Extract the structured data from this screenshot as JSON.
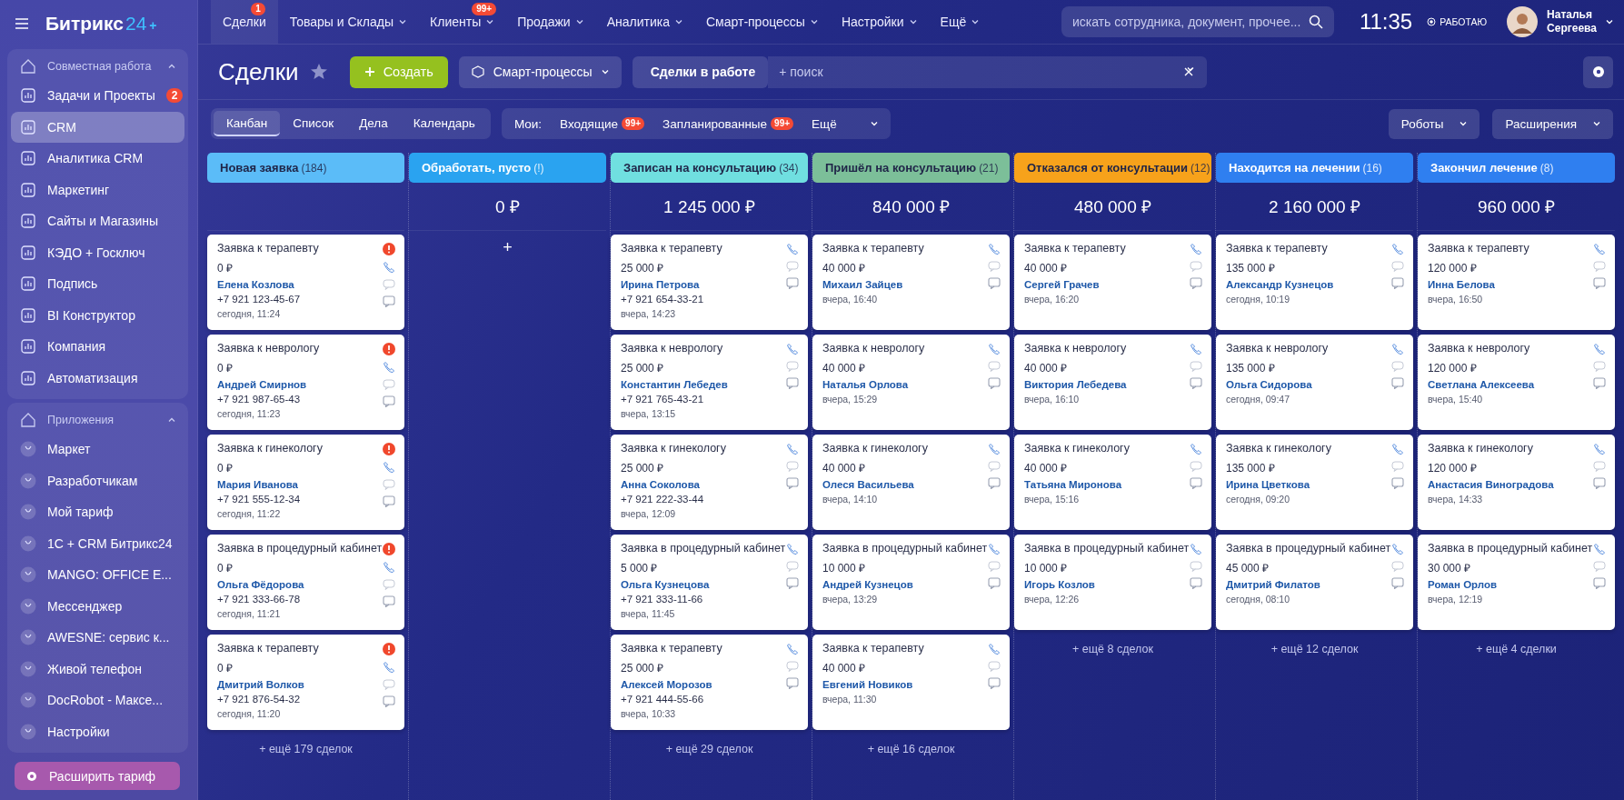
{
  "logo": {
    "name": "Битрикс",
    "number": "24",
    "plus": "+"
  },
  "top_nav": [
    {
      "label": "Сделки",
      "selected": true,
      "badge": "1",
      "dropdown": false
    },
    {
      "label": "Товары и Склады",
      "selected": false,
      "dropdown": true
    },
    {
      "label": "Клиенты",
      "selected": false,
      "badge": "99+",
      "dropdown": true
    },
    {
      "label": "Продажи",
      "selected": false,
      "dropdown": true
    },
    {
      "label": "Аналитика",
      "selected": false,
      "dropdown": true
    },
    {
      "label": "Смарт-процессы",
      "selected": false,
      "dropdown": true
    },
    {
      "label": "Настройки",
      "selected": false,
      "dropdown": true
    },
    {
      "label": "Ещё",
      "selected": false,
      "dropdown": true
    }
  ],
  "global_search": {
    "placeholder": "искать сотрудника, документ, прочее..."
  },
  "clock": "11:35",
  "work_status": "РАБОТАЮ",
  "user": {
    "first_name": "Наталья",
    "last_name": "Сергеева"
  },
  "sidebar": {
    "groups": [
      {
        "title": "Совместная работа",
        "expanded": true,
        "items": [
          {
            "label": "Задачи и Проекты",
            "selected": false,
            "badge": "2"
          },
          {
            "label": "CRM",
            "selected": true
          },
          {
            "label": "Аналитика CRM",
            "selected": false
          },
          {
            "label": "Маркетинг",
            "selected": false
          },
          {
            "label": "Сайты и Магазины",
            "selected": false
          },
          {
            "label": "КЭДО + Госключ",
            "selected": false
          },
          {
            "label": "Подпись",
            "selected": false
          },
          {
            "label": "BI Конструктор",
            "selected": false
          },
          {
            "label": "Компания",
            "selected": false
          },
          {
            "label": "Автоматизация",
            "selected": false
          }
        ]
      },
      {
        "title": "Приложения",
        "expanded": true,
        "items": [
          {
            "label": "Маркет",
            "selected": false
          },
          {
            "label": "Разработчикам",
            "selected": false
          },
          {
            "label": "Мой тариф",
            "selected": false
          },
          {
            "label": "1С + CRM Битрикс24",
            "selected": false
          },
          {
            "label": "MANGO: OFFICE E...",
            "selected": false
          },
          {
            "label": "Мессенджер",
            "selected": false
          },
          {
            "label": "AWESNE: сервис к...",
            "selected": false
          },
          {
            "label": "Живой телефон",
            "selected": false
          },
          {
            "label": "DocRobot - Максе...",
            "selected": false
          },
          {
            "label": "Настройки",
            "selected": false
          }
        ]
      }
    ],
    "upgrade_button": "Расширить тариф"
  },
  "page_title": "Сделки",
  "create_button": "Создать",
  "smart_button": "Смарт-процессы",
  "filter": {
    "preset": "Сделки в работе",
    "placeholder": "+ поиск"
  },
  "view_tabs": [
    {
      "label": "Канбан",
      "selected": true
    },
    {
      "label": "Список",
      "selected": false
    },
    {
      "label": "Дела",
      "selected": false
    },
    {
      "label": "Календарь",
      "selected": false
    }
  ],
  "my_filter": {
    "label": "Мои:",
    "items": [
      {
        "label": "Входящие",
        "badge": "99+"
      },
      {
        "label": "Запланированные",
        "badge": "99+"
      },
      {
        "label": "Ещё",
        "dropdown": true
      }
    ]
  },
  "right_buttons": [
    "Роботы",
    "Расширения"
  ],
  "columns": [
    {
      "title": "Новая заявка",
      "count": "(184)",
      "color": "#5bbcf8",
      "more": "+ ещё 179 сделок",
      "cards": [
        {
          "title": "Заявка к терапевту",
          "amount": "0 ₽",
          "contact": "Елена Козлова",
          "phone": "+7 921 123-45-67",
          "date": "сегодня, 11:24",
          "alert": true
        },
        {
          "title": "Заявка к неврологу",
          "amount": "0 ₽",
          "contact": "Андрей Смирнов",
          "phone": "+7 921 987-65-43",
          "date": "сегодня, 11:23",
          "alert": true
        },
        {
          "title": "Заявка к гинекологу",
          "amount": "0 ₽",
          "contact": "Мария Иванова",
          "phone": "+7 921 555-12-34",
          "date": "сегодня, 11:22",
          "alert": true
        },
        {
          "title": "Заявка в процедурный кабинет",
          "amount": "0 ₽",
          "contact": "Ольга Фёдорова",
          "phone": "+7 921 333-66-78",
          "date": "сегодня, 11:21",
          "alert": true
        },
        {
          "title": "Заявка к терапевту",
          "amount": "0 ₽",
          "contact": "Дмитрий Волков",
          "phone": "+7 921 876-54-32",
          "date": "сегодня, 11:20",
          "alert": true
        }
      ]
    },
    {
      "title": "Обработать, пусто",
      "count": "(!)",
      "color": "#2aa3f0",
      "sum": "0 ₽",
      "add": "+"
    },
    {
      "title": "Записан на консультацию",
      "count": "(34)",
      "color": "#70dfe0",
      "sum": "1 245 000 ₽",
      "more": "+ ещё 29 сделок",
      "cards": [
        {
          "title": "Заявка к терапевту",
          "amount": "25 000 ₽",
          "contact": "Ирина Петрова",
          "phone": "+7 921 654-33-21",
          "date": "вчера, 14:23",
          "alert": false
        },
        {
          "title": "Заявка к неврологу",
          "amount": "25 000 ₽",
          "contact": "Константин Лебедев",
          "phone": "+7 921 765-43-21",
          "date": "вчера, 13:15",
          "alert": false
        },
        {
          "title": "Заявка к гинекологу",
          "amount": "25 000 ₽",
          "contact": "Анна Соколова",
          "phone": "+7 921 222-33-44",
          "date": "вчера, 12:09",
          "alert": false
        },
        {
          "title": "Заявка в процедурный кабинет",
          "amount": "5 000 ₽",
          "contact": "Ольга Кузнецова",
          "phone": "+7 921 333-11-66",
          "date": "вчера, 11:45",
          "alert": false
        },
        {
          "title": "Заявка к терапевту",
          "amount": "25 000 ₽",
          "contact": "Алексей Морозов",
          "phone": "+7 921 444-55-66",
          "date": "вчера, 10:33",
          "alert": false
        }
      ]
    },
    {
      "title": "Пришёл на консультацию",
      "count": "(21)",
      "color": "#7cbf99",
      "sum": "840 000 ₽",
      "more": "+ ещё 16 сделок",
      "cards": [
        {
          "title": "Заявка к терапевту",
          "amount": "40 000 ₽",
          "contact": "Михаил Зайцев",
          "date": "вчера, 16:40",
          "alert": false
        },
        {
          "title": "Заявка к неврологу",
          "amount": "40 000 ₽",
          "contact": "Наталья Орлова",
          "date": "вчера, 15:29",
          "alert": false
        },
        {
          "title": "Заявка к гинекологу",
          "amount": "40 000 ₽",
          "contact": "Олеся Васильева",
          "date": "вчера, 14:10",
          "alert": false
        },
        {
          "title": "Заявка в процедурный кабинет",
          "amount": "10 000 ₽",
          "contact": "Андрей Кузнецов",
          "date": "вчера, 13:29",
          "alert": false
        },
        {
          "title": "Заявка к терапевту",
          "amount": "40 000 ₽",
          "contact": "Евгений Новиков",
          "date": "вчера, 11:30",
          "alert": false
        }
      ]
    },
    {
      "title": "Отказался от консультации",
      "count": "(12)",
      "color": "#f7a21b",
      "sum": "480 000 ₽",
      "more": "+ ещё 8 сделок",
      "cards": [
        {
          "title": "Заявка к терапевту",
          "amount": "40 000 ₽",
          "contact": "Сергей Грачев",
          "date": "вчера, 16:20",
          "alert": false
        },
        {
          "title": "Заявка к неврологу",
          "amount": "40 000 ₽",
          "contact": "Виктория Лебедева",
          "date": "вчера, 16:10",
          "alert": false
        },
        {
          "title": "Заявка к гинекологу",
          "amount": "40 000 ₽",
          "contact": "Татьяна Миронова",
          "date": "вчера, 15:16",
          "alert": false
        },
        {
          "title": "Заявка в процедурный кабинет",
          "amount": "10 000 ₽",
          "contact": "Игорь Козлов",
          "date": "вчера, 12:26",
          "alert": false
        }
      ]
    },
    {
      "title": "Находится на лечении",
      "count": "(16)",
      "color": "#2f7ff0",
      "sum": "2 160 000 ₽",
      "more": "+ ещё 12 сделок",
      "cards": [
        {
          "title": "Заявка к терапевту",
          "amount": "135 000 ₽",
          "contact": "Александр Кузнецов",
          "date": "сегодня, 10:19",
          "alert": false
        },
        {
          "title": "Заявка к неврологу",
          "amount": "135 000 ₽",
          "contact": "Ольга Сидорова",
          "date": "сегодня, 09:47",
          "alert": false
        },
        {
          "title": "Заявка к гинекологу",
          "amount": "135 000 ₽",
          "contact": "Ирина Цветкова",
          "date": "сегодня, 09:20",
          "alert": false
        },
        {
          "title": "Заявка в процедурный кабинет",
          "amount": "45 000 ₽",
          "contact": "Дмитрий Филатов",
          "date": "сегодня, 08:10",
          "alert": false
        }
      ]
    },
    {
      "title": "Закончил лечение",
      "count": "(8)",
      "color": "#2f7ff0",
      "sum": "960 000 ₽",
      "more": "+ ещё 4 сделки",
      "cards": [
        {
          "title": "Заявка к терапевту",
          "amount": "120 000 ₽",
          "contact": "Инна Белова",
          "date": "вчера, 16:50",
          "alert": false
        },
        {
          "title": "Заявка к неврологу",
          "amount": "120 000 ₽",
          "contact": "Светлана Алексеева",
          "date": "вчера, 15:40",
          "alert": false
        },
        {
          "title": "Заявка к гинекологу",
          "amount": "120 000 ₽",
          "contact": "Анастасия Виноградова",
          "date": "вчера, 14:33",
          "alert": false
        },
        {
          "title": "Заявка в процедурный кабинет",
          "amount": "30 000 ₽",
          "contact": "Роман Орлов",
          "date": "вчера, 12:19",
          "alert": false
        }
      ]
    }
  ]
}
